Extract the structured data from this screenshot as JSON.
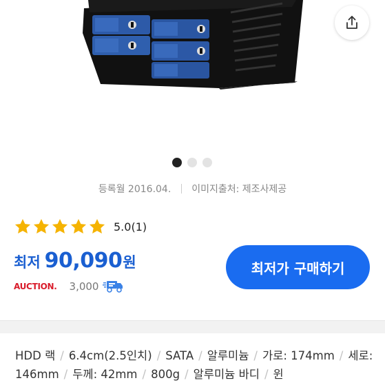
{
  "product": {
    "registered": "등록월 2016.04.",
    "image_source": "이미지출처: 제조사제공"
  },
  "rating": {
    "stars": 5,
    "score": "5.0",
    "count": "(1)"
  },
  "price": {
    "label": "최저",
    "value": "90,090",
    "unit": "원"
  },
  "seller": {
    "name": "AUCTION.",
    "shipping_fee": "3,000"
  },
  "buy_button": {
    "label": "최저가 구매하기"
  },
  "gallery": {
    "slides": 3,
    "active_index": 0
  },
  "specs": [
    "HDD 랙",
    "6.4cm(2.5인치)",
    "SATA",
    "알루미늄",
    "가로: 174mm",
    "세로: 146mm",
    "두께: 42mm",
    "800g",
    "알루미늄 바디",
    "윈"
  ],
  "colors": {
    "accent": "#1a6cf0",
    "price": "#1a5fd1",
    "star": "#f5b301",
    "auction": "#d91c2b"
  }
}
